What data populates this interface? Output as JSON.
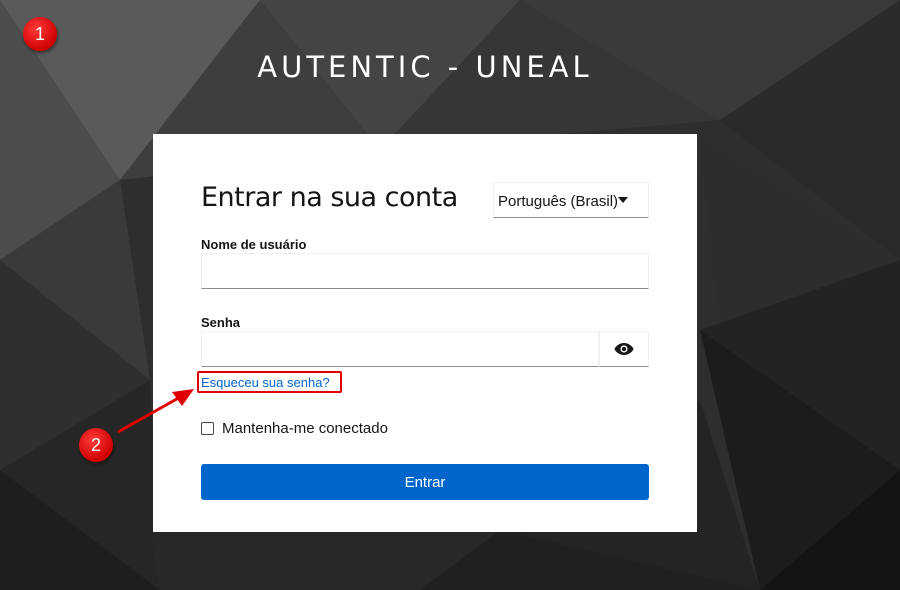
{
  "header": {
    "realm_title": "AUTENTIC - UNEAL"
  },
  "login": {
    "title": "Entrar na sua conta",
    "language_selected": "Português (Brasil)",
    "username_label": "Nome de usuário",
    "username_value": "",
    "password_label": "Senha",
    "password_value": "",
    "forgot_password": "Esqueceu sua senha?",
    "remember_me": "Mantenha-me conectado",
    "submit_label": "Entrar"
  },
  "annotations": {
    "step1": "1",
    "step2": "2"
  },
  "colors": {
    "primary": "#0066cc",
    "annotation_red": "#e00000",
    "background_dark": "#2b2b2b"
  }
}
